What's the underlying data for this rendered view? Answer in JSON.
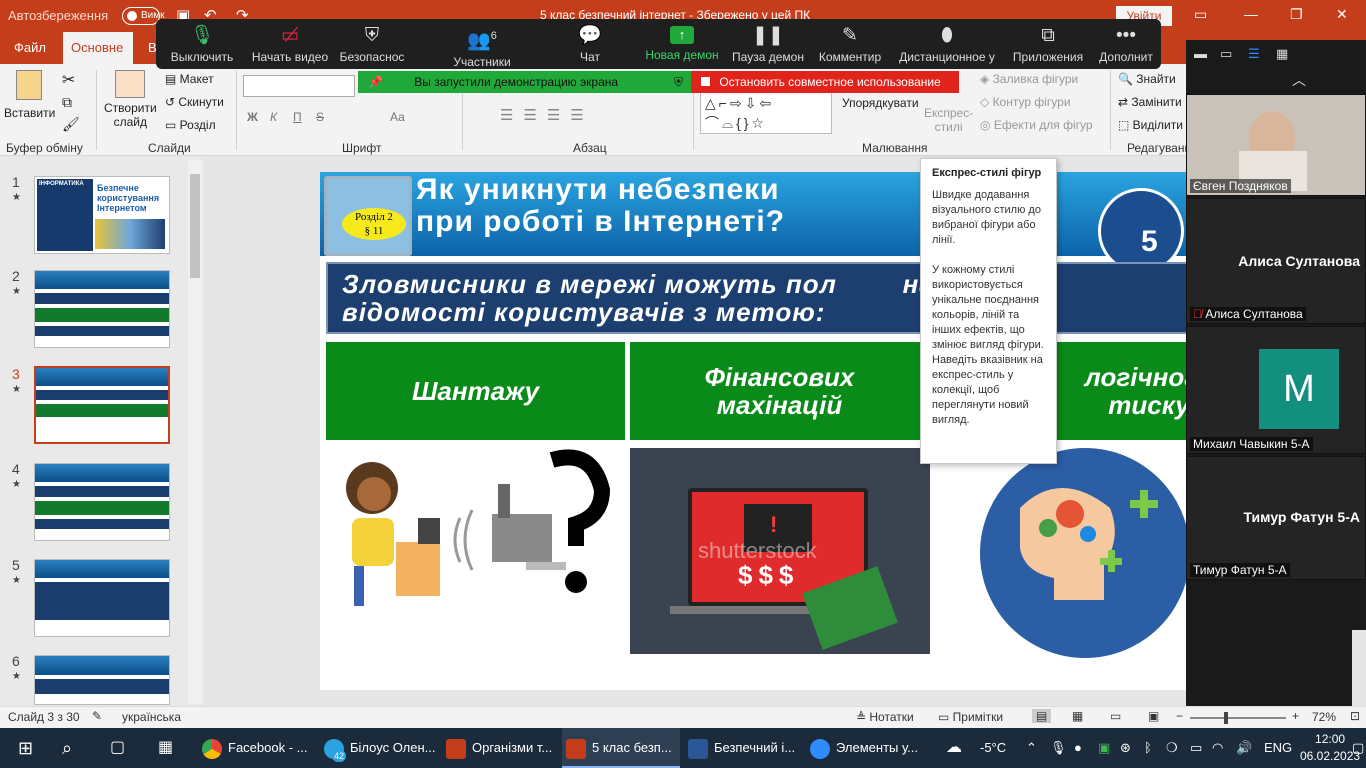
{
  "titlebar": {
    "autosave": "Автозбереження",
    "toggle_state": "Вимк",
    "document_title": "5 клас безпечний інтернет - Збережено у цей ПК",
    "signin": "Увійти"
  },
  "tabs": [
    "Файл",
    "Основне",
    "В"
  ],
  "ribbon": {
    "paste": "Вставити",
    "clipboard_group": "Буфер обміну",
    "new_slide": "Створити",
    "new_slide_2": "слайд",
    "layout": "Макет",
    "reset": "Скинути",
    "section": "Розділ",
    "slides_group": "Слайди",
    "font_group": "Шрифт",
    "font_bold": "Ж",
    "font_italic": "К",
    "font_underline": "П",
    "font_strike": "S",
    "font_size_label": "Аа",
    "paragraph_group": "Абзац",
    "drawing_group": "Малювання",
    "arrange": "Упорядкувати",
    "quick_styles": "Експрес-",
    "quick_styles_2": "стилі",
    "shape_fill": "Заливка фігури",
    "shape_outline": "Контур фігури",
    "shape_effects": "Ефекти для фігур",
    "find": "Знайти",
    "replace": "Замінити",
    "select": "Виділити",
    "editing_group": "Редагування"
  },
  "zoom": {
    "mute": "Выключить",
    "video": "Начать видео",
    "security": "Безопаснос",
    "participants": "Участники",
    "participants_count": "6",
    "chat": "Чат",
    "new_share": "Новая демон",
    "pause_share": "Пауза демон",
    "annotate": "Комментир",
    "remote": "Дистанционное у",
    "apps": "Приложения",
    "more": "Дополнит",
    "sharing_banner": "Вы запустили демонстрацию экрана",
    "stop_share": "Остановить совместное использование"
  },
  "slides_pane": {
    "items": [
      {
        "num": "1",
        "star": "★"
      },
      {
        "num": "2",
        "star": "★"
      },
      {
        "num": "3",
        "star": "★"
      },
      {
        "num": "4",
        "star": "★"
      },
      {
        "num": "5",
        "star": "★"
      },
      {
        "num": "6",
        "star": "★"
      }
    ],
    "thumb1_title": "Безпечне користування Інтернетом",
    "thumb1_brand": "ІНФОРМАТИКА"
  },
  "slide": {
    "title": "Як уникнути небезпеки\nпри роботі в Інтернеті?",
    "badge_line1": "Розділ 2",
    "badge_line2": "§ 11",
    "logo_number": "5",
    "subtitle": "Зловмисники в мережі можуть пол        на особи\nвідомості користувачів з метою:",
    "box1": "Шантажу",
    "box2": "Фінансових махінацій",
    "box3": "логічного тиску",
    "watermark": "shutterstock"
  },
  "tooltip": {
    "title": "Експрес-стилі фігур",
    "p1": "Швидке додавання візуального стилю до вибраної фігури або лінії.",
    "p2": "У кожному стилі використовується унікальне поєднання кольорів, ліній та інших ефектів, що змінює вигляд фігури. Наведіть вказівник на експрес-стиль у колекції, щоб переглянути новий вигляд."
  },
  "participants": {
    "p1_name": "Євген Поздняков",
    "p2_big": "Алиса Султанова",
    "p2_name": "Алиса Султанова",
    "p3_initial": "M",
    "p3_name": "Михаил Чавыкин 5-А",
    "p4_big": "Тимур Фатун 5-А",
    "p4_name": "Тимур Фатун 5-А"
  },
  "status": {
    "slide_of": "Слайд 3 з 30",
    "language": "українська",
    "notes": "Нотатки",
    "comments": "Примітки",
    "zoom_pct": "72%"
  },
  "taskbar": {
    "items": [
      "Facebook - ...",
      "Білоус Олен...",
      "Організми т...",
      "5 клас безп...",
      "Безпечний і...",
      "Элементы у..."
    ],
    "telegram_badge": "42",
    "temp": "-5°C",
    "lang": "ENG",
    "time": "12:00",
    "date": "06.02.2023"
  },
  "colors": {
    "accent": "#c43e1c",
    "zoom_green": "#20a83a",
    "zoom_red": "#e0241b",
    "slide_green": "#0a8a18",
    "slide_navy": "#1c3f70"
  }
}
